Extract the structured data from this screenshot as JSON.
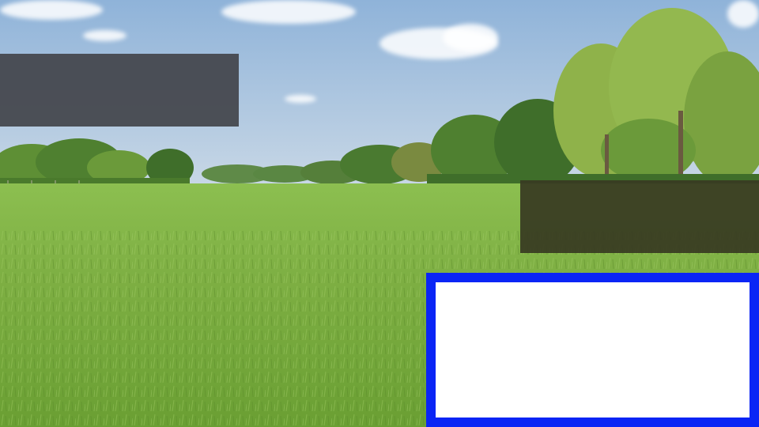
{
  "scene": {
    "description_tag": "meadow",
    "colors": {
      "sky_top": "#8fb3d9",
      "sky_bottom": "#c9d8e6",
      "tree_dark": "#3f6e2a",
      "tree_mid": "#5e8f35",
      "tree_light": "#8fb24a",
      "grass_far": "#7fb044",
      "grass_near": "#6a9f33",
      "grass_stripe": "#8cbf50"
    }
  },
  "overlays": {
    "dark_top": {
      "color": "#474a52",
      "opacity": 0.97
    },
    "dark_right": {
      "color": "#373a22",
      "opacity": 0.92
    },
    "frame": {
      "border_color": "#0a25f5",
      "fill_color": "#ffffff"
    }
  }
}
